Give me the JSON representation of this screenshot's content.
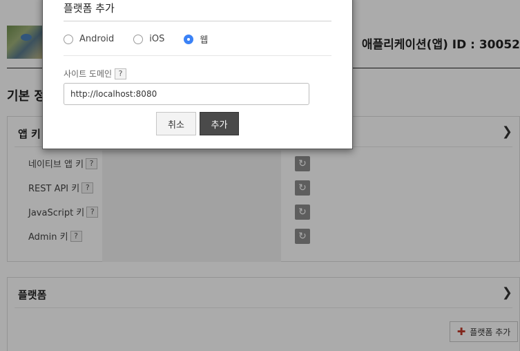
{
  "page": {
    "app_id_label": "애플리케이션(앱) ID : 30052",
    "section_title": "기본 정보",
    "keys_panel": {
      "title": "앱 키",
      "rows": [
        {
          "label": "네이티브 앱 키",
          "help": "?"
        },
        {
          "label": "REST API 키",
          "help": "?"
        },
        {
          "label": "JavaScript 키",
          "help": "?"
        },
        {
          "label": "Admin 키",
          "help": "?"
        }
      ]
    },
    "platform_panel": {
      "title": "플랫폼",
      "add_button_label": "플랫폼 추가"
    }
  },
  "modal": {
    "title": "플랫폼 추가",
    "radio_options": [
      {
        "label": "Android",
        "checked": false
      },
      {
        "label": "iOS",
        "checked": false
      },
      {
        "label": "웹",
        "checked": true
      }
    ],
    "domain_label": "사이트 도메인",
    "domain_help": "?",
    "domain_value": "http://localhost:8080",
    "cancel_label": "취소",
    "add_label": "추가"
  },
  "colors": {
    "radio_checked": "#3b82f6",
    "primary_button": "#4a4a4a",
    "add_plus": "#c0392b"
  },
  "icons": {
    "chevron": "chevron-down-icon",
    "refresh": "refresh-icon",
    "plus": "plus-icon"
  }
}
